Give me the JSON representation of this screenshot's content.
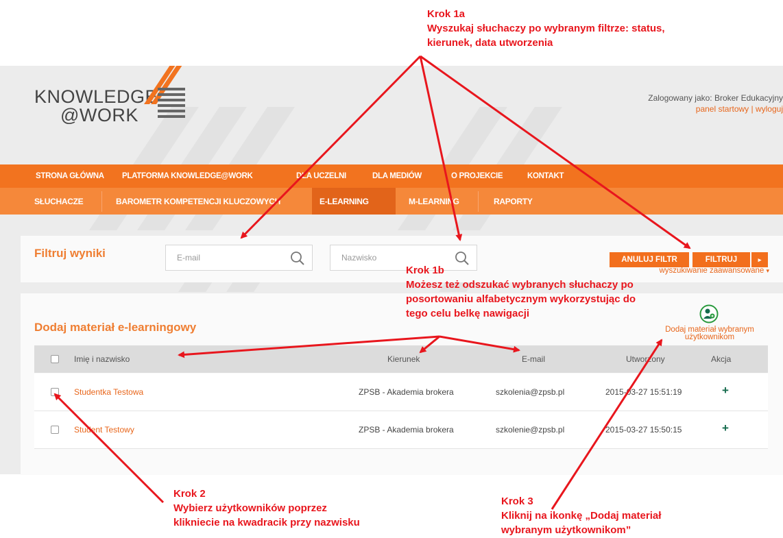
{
  "header": {
    "logo_line1": "KNOWLEDGE",
    "logo_line2": "@WORK",
    "logged_in_text": "Zalogowany jako: Broker Edukacyjny",
    "link_start_panel": "panel startowy",
    "link_separator": "|",
    "link_logout": "wyloguj"
  },
  "nav_main": {
    "items": [
      "STRONA GŁÓWNA",
      "PLATFORMA KNOWLEDGE@WORK",
      "DLA UCZELNI",
      "DLA MEDIÓW",
      "O PROJEKCIE",
      "KONTAKT"
    ]
  },
  "nav_sub": {
    "items": [
      "SŁUCHACZE",
      "BAROMETR KOMPETENCJI KLUCZOWYCH",
      "E-LEARNING",
      "M-LEARNING",
      "RAPORTY"
    ],
    "active": "E-LEARNING"
  },
  "filter": {
    "title": "Filtruj wyniki",
    "email_placeholder": "E-mail",
    "surname_placeholder": "Nazwisko",
    "cancel_button": "ANULUJ FILTR",
    "filter_button": "FILTRUJ",
    "dropdown_caret": "▸",
    "advanced_search": "wyszukiwanie zaawansowane",
    "advanced_caret": "▾"
  },
  "section": {
    "title": "Dodaj materiał e-learningowy",
    "add_selected_line1": "Dodaj materiał wybranym",
    "add_selected_line2": "użytkownikom"
  },
  "table": {
    "headers": {
      "name": "Imię i nazwisko",
      "major": "Kierunek",
      "email": "E-mail",
      "created": "Utworzony",
      "action": "Akcja"
    },
    "rows": [
      {
        "name": "Studentka Testowa",
        "major": "ZPSB - Akademia brokera",
        "email": "szkolenia@zpsb.pl",
        "created": "2015-03-27 15:51:19",
        "action": "+"
      },
      {
        "name": "Student Testowy",
        "major": "ZPSB - Akademia brokera",
        "email": "szkolenie@zpsb.pl",
        "created": "2015-03-27 15:50:15",
        "action": "+"
      }
    ]
  },
  "annotations": {
    "step1a": [
      "Krok 1a",
      "Wyszukaj słuchaczy po wybranym filtrze: status,",
      "kierunek, data utworzenia"
    ],
    "step1b": [
      "Krok 1b",
      "Możesz też odszukać wybranych słuchaczy po",
      "posortowaniu  alfabetycznym wykorzystując do",
      "tego celu belkę nawigacji"
    ],
    "step2": [
      "Krok 2",
      "Wybierz użytkowników poprzez",
      "klikniecie na kwadracik przy nazwisku"
    ],
    "step3": [
      "Krok 3",
      "Kliknij na ikonkę  „Dodaj materiał",
      "wybranym użytkownikom”"
    ]
  },
  "colors": {
    "brand_orange": "#f2731f",
    "annotation_red": "#e8161d",
    "action_green": "#156b4d"
  }
}
